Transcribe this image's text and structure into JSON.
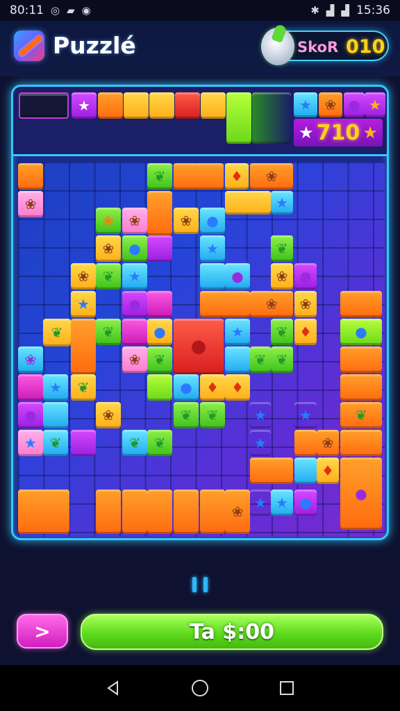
{
  "status_bar": {
    "time": "80:11",
    "left_icons": [
      "target-icon",
      "message-icon",
      "game-icon"
    ],
    "right_icons": [
      "bluetooth-icon",
      "signal-icon",
      "signal-icon"
    ],
    "clock": "15:36"
  },
  "header": {
    "title": "Puzzlé",
    "score_label": "SkoR",
    "score_value": "010"
  },
  "board": {
    "mini_score": "710",
    "glyphs": {
      "star": "★",
      "leaf": "❦",
      "blob": "●",
      "animal": "❀",
      "drop": "♦"
    }
  },
  "controls": {
    "next_label": ">",
    "main_label": "Ta $:00"
  },
  "colors": {
    "accent": "#35c8ff",
    "score": "#ffd21a",
    "primary_button": "#5ad81a",
    "secondary_button": "#d21ec0"
  }
}
